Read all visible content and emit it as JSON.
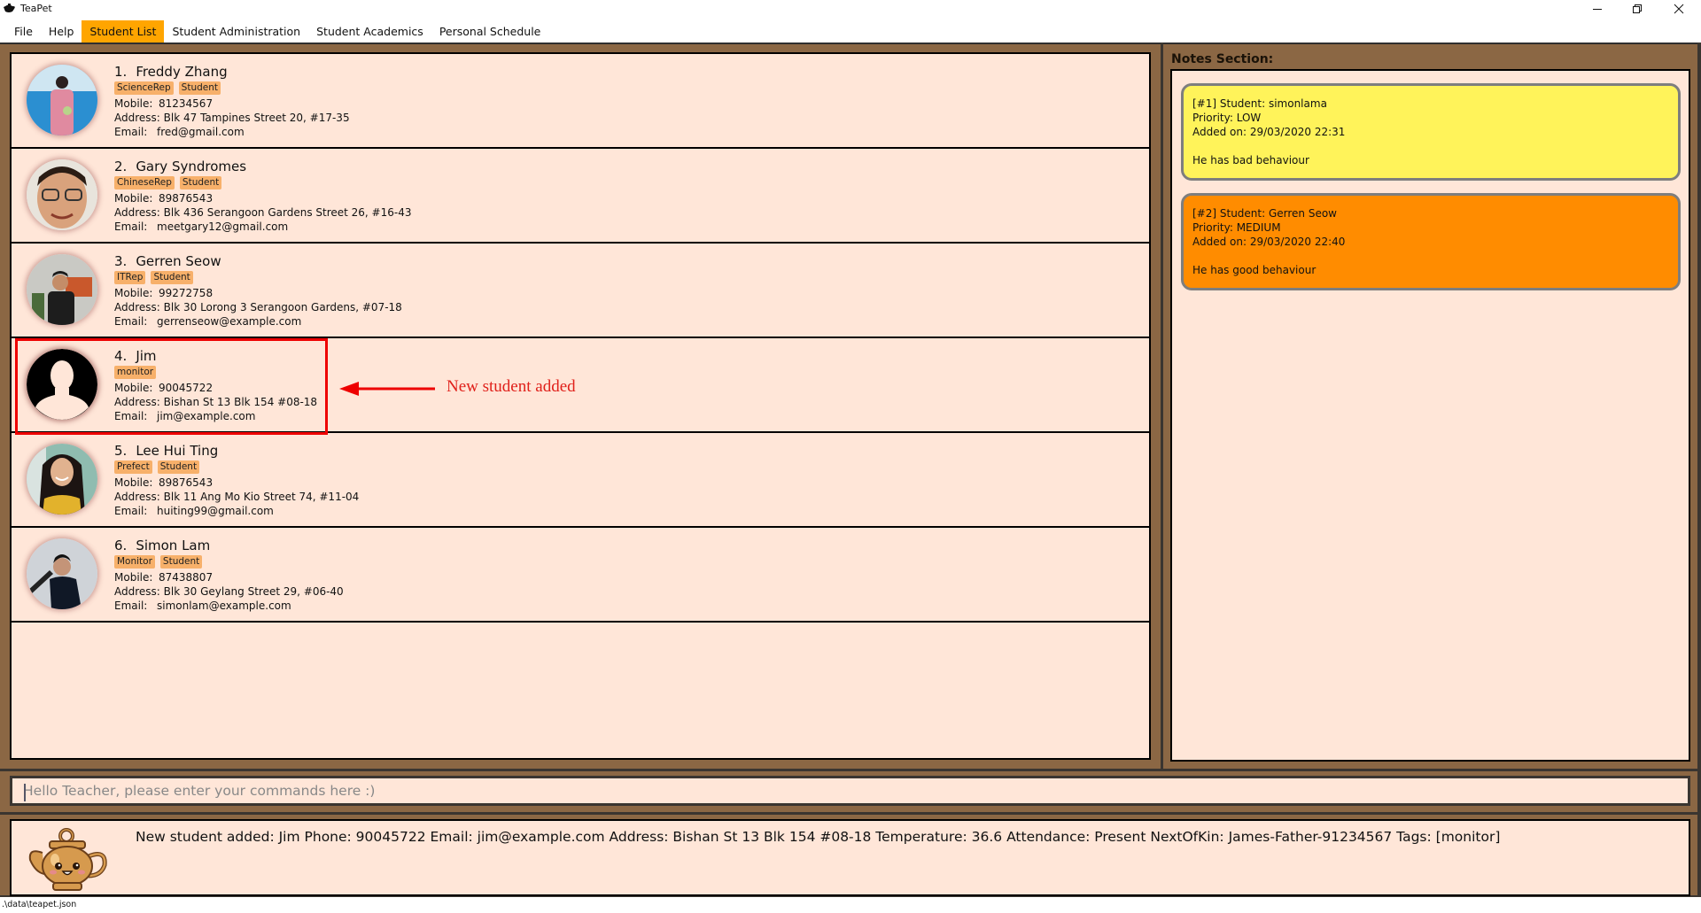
{
  "window": {
    "title": "TeaPet",
    "controls": [
      "minimize",
      "restore",
      "close"
    ]
  },
  "menu": {
    "items": [
      {
        "label": "File",
        "active": false
      },
      {
        "label": "Help",
        "active": false
      },
      {
        "label": "Student List",
        "active": true
      },
      {
        "label": "Student Administration",
        "active": false
      },
      {
        "label": "Student Academics",
        "active": false
      },
      {
        "label": "Personal Schedule",
        "active": false
      }
    ]
  },
  "students": [
    {
      "index": "1.",
      "name": "Freddy Zhang",
      "tags": [
        "ScienceRep",
        "Student"
      ],
      "mobile_label": "Mobile:",
      "mobile": "81234567",
      "address_label": "Address:",
      "address": "Blk 47 Tampines Street 20, #17-35",
      "email_label": "Email:",
      "email": "fred@gmail.com",
      "avatar": "photo-beach"
    },
    {
      "index": "2.",
      "name": "Gary Syndromes",
      "tags": [
        "ChineseRep",
        "Student"
      ],
      "mobile_label": "Mobile:",
      "mobile": "89876543",
      "address_label": "Address:",
      "address": "Blk 436 Serangoon Gardens Street 26, #16-43",
      "email_label": "Email:",
      "email": "meetgary12@gmail.com",
      "avatar": "photo-glasses"
    },
    {
      "index": "3.",
      "name": "Gerren Seow",
      "tags": [
        "ITRep",
        "Student"
      ],
      "mobile_label": "Mobile:",
      "mobile": "99272758",
      "address_label": "Address:",
      "address": "Blk 30 Lorong 3 Serangoon Gardens, #07-18",
      "email_label": "Email:",
      "email": "gerrenseow@example.com",
      "avatar": "photo-cafe"
    },
    {
      "index": "4.",
      "name": "Jim",
      "tags": [
        "monitor"
      ],
      "mobile_label": "Mobile:",
      "mobile": "90045722",
      "address_label": "Address:",
      "address": "Bishan St 13 Blk 154 #08-18",
      "email_label": "Email:",
      "email": "jim@example.com",
      "avatar": "default-silhouette"
    },
    {
      "index": "5.",
      "name": "Lee Hui Ting",
      "tags": [
        "Prefect",
        "Student"
      ],
      "mobile_label": "Mobile:",
      "mobile": "89876543",
      "address_label": "Address:",
      "address": "Blk 11 Ang Mo Kio Street 74, #11-04",
      "email_label": "Email:",
      "email": "huiting99@gmail.com",
      "avatar": "photo-girl"
    },
    {
      "index": "6.",
      "name": "Simon Lam",
      "tags": [
        "Monitor",
        "Student"
      ],
      "mobile_label": "Mobile:",
      "mobile": "87438807",
      "address_label": "Address:",
      "address": "Blk 30 Geylang Street 29, #06-40",
      "email_label": "Email:",
      "email": "simonlam@example.com",
      "avatar": "photo-stairs"
    }
  ],
  "annotation": {
    "text": "New student added",
    "color": "#e0201a"
  },
  "notes": {
    "title": "Notes Section:",
    "items": [
      {
        "header": "[#1] Student: simonlama",
        "priority": "Priority: LOW",
        "added": "Added on: 29/03/2020 22:31",
        "body": "He has bad behaviour",
        "color": "#fff35a"
      },
      {
        "header": "[#2] Student: Gerren Seow",
        "priority": "Priority: MEDIUM",
        "added": "Added on: 29/03/2020 22:40",
        "body": "He has good behaviour",
        "color": "#ff8c00"
      }
    ]
  },
  "command": {
    "placeholder": "Hello Teacher, please enter your commands here :)",
    "value": ""
  },
  "result": {
    "message": "New student added: Jim Phone: 90045722 Email: jim@example.com Address: Bishan St 13 Blk 154 #08-18 Temperature: 36.6 Attendance: Present NextOfKin: James-Father-91234567 Tags: [monitor]"
  },
  "status": {
    "file_path": ".\\data\\teapet.json"
  },
  "colors": {
    "frame": "#8b6744",
    "panel": "#ffe6d8",
    "active_menu": "#ffa500",
    "tag": "#f7b06a"
  }
}
